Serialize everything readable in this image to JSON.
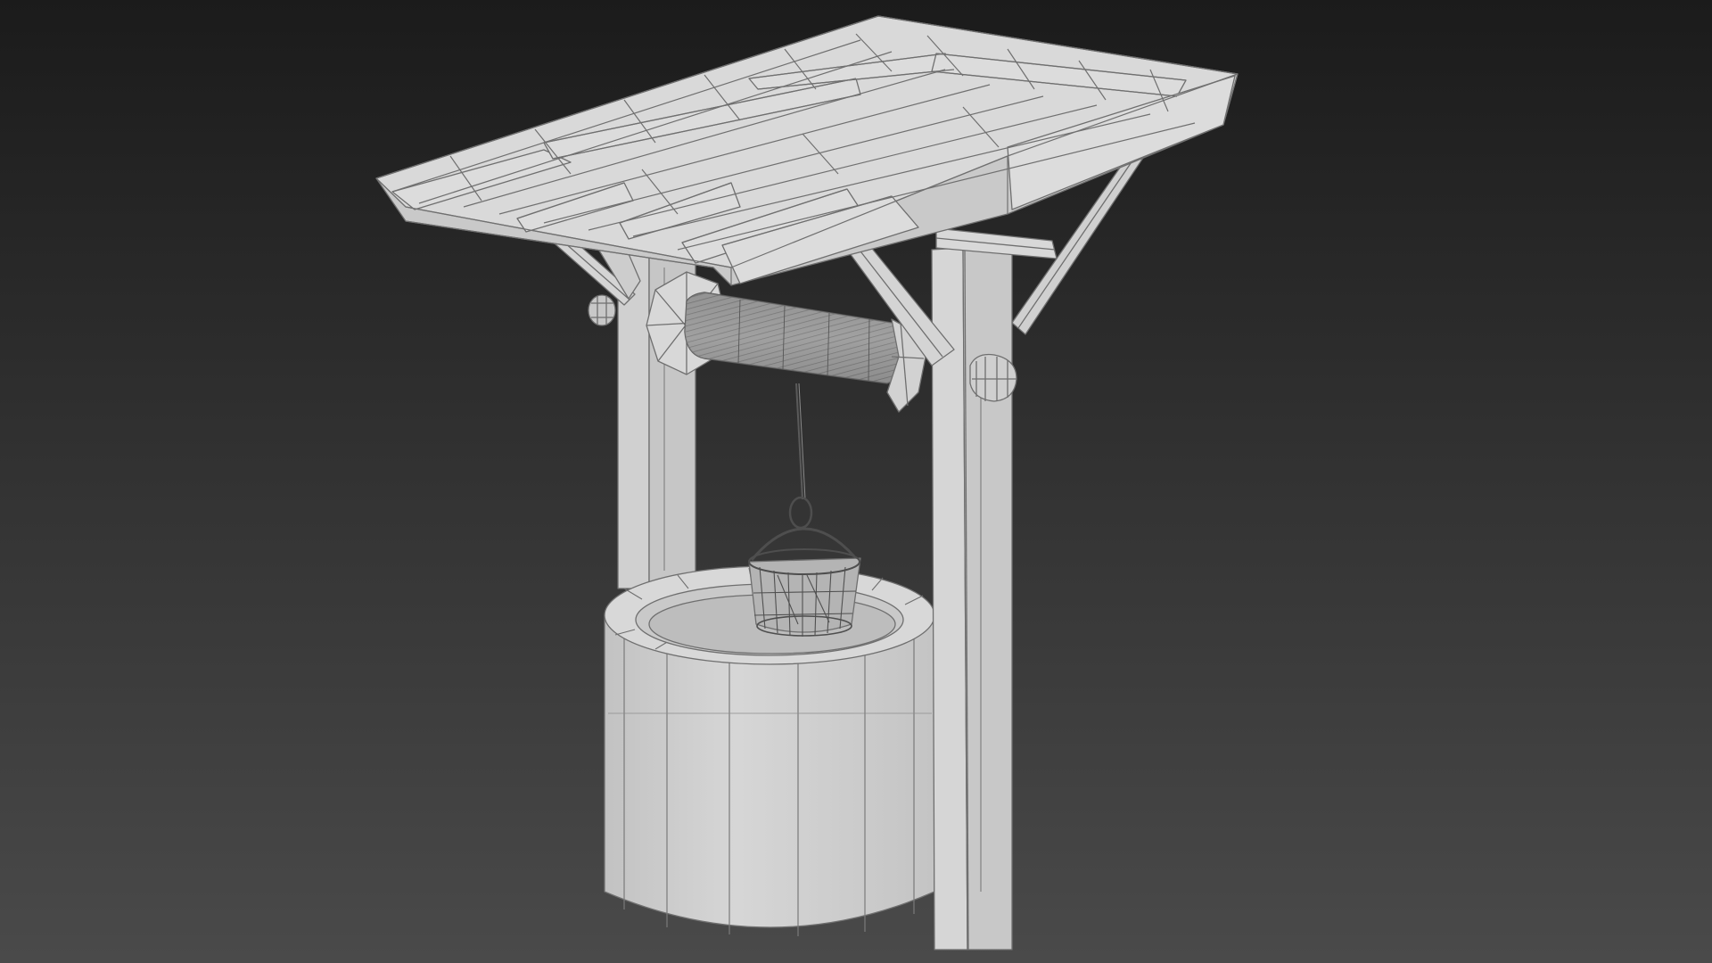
{
  "viewport": {
    "mode": "wireframe-on-shaded",
    "background": {
      "top": "#1b1b1b",
      "bottom": "#4a4a4a"
    },
    "colors": {
      "mesh_fill": "#d2d2d2",
      "mesh_fill_light": "#dcdcdc",
      "mesh_fill_shadow": "#b9b9b9",
      "wire": "#6f6f6f",
      "wire_dense": "#5a5a5a",
      "dark_interior": "#9a9a9a"
    }
  },
  "model": {
    "object": "wishing-well",
    "parts": [
      "roof",
      "roof-braces",
      "posts",
      "crank-axle",
      "axle-pegs",
      "rope",
      "bucket",
      "well-ring"
    ]
  }
}
